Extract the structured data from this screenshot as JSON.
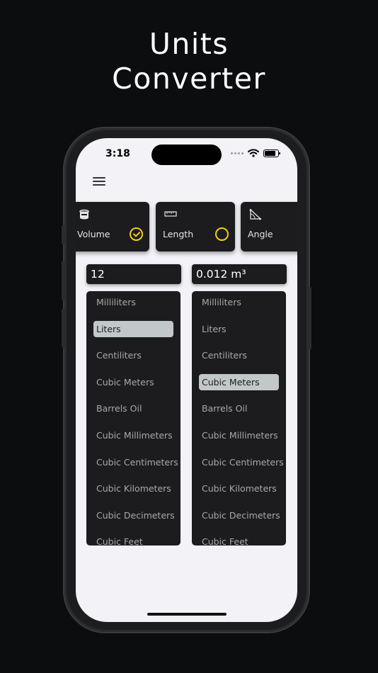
{
  "promo": {
    "title_line1": "Units",
    "title_line2": "Converter"
  },
  "status_bar": {
    "time": "3:18"
  },
  "categories": [
    {
      "label": "Volume",
      "icon": "barrel-icon",
      "selected": true
    },
    {
      "label": "Length",
      "icon": "ruler-icon",
      "selected": false
    },
    {
      "label": "Angle",
      "icon": "angle-icon",
      "selected": false
    }
  ],
  "converter": {
    "input_value": "12",
    "output_value": "0.012 m³",
    "from_units": [
      "Milliliters",
      "Liters",
      "Centiliters",
      "Cubic Meters",
      "Barrels Oil",
      "Cubic Millimeters",
      "Cubic Centimeters",
      "Cubic Kilometers",
      "Cubic Decimeters",
      "Cubic Feet"
    ],
    "to_units": [
      "Milliliters",
      "Liters",
      "Centiliters",
      "Cubic Meters",
      "Barrels Oil",
      "Cubic Millimeters",
      "Cubic Centimeters",
      "Cubic Kilometers",
      "Cubic Decimeters",
      "Cubic Feet"
    ],
    "from_selected": "Liters",
    "to_selected": "Cubic Meters"
  },
  "colors": {
    "accent": "#f5cc12",
    "card_bg": "#1c1c1e",
    "selection": "#c2c7ca",
    "screen_bg": "#f2f2f7"
  }
}
